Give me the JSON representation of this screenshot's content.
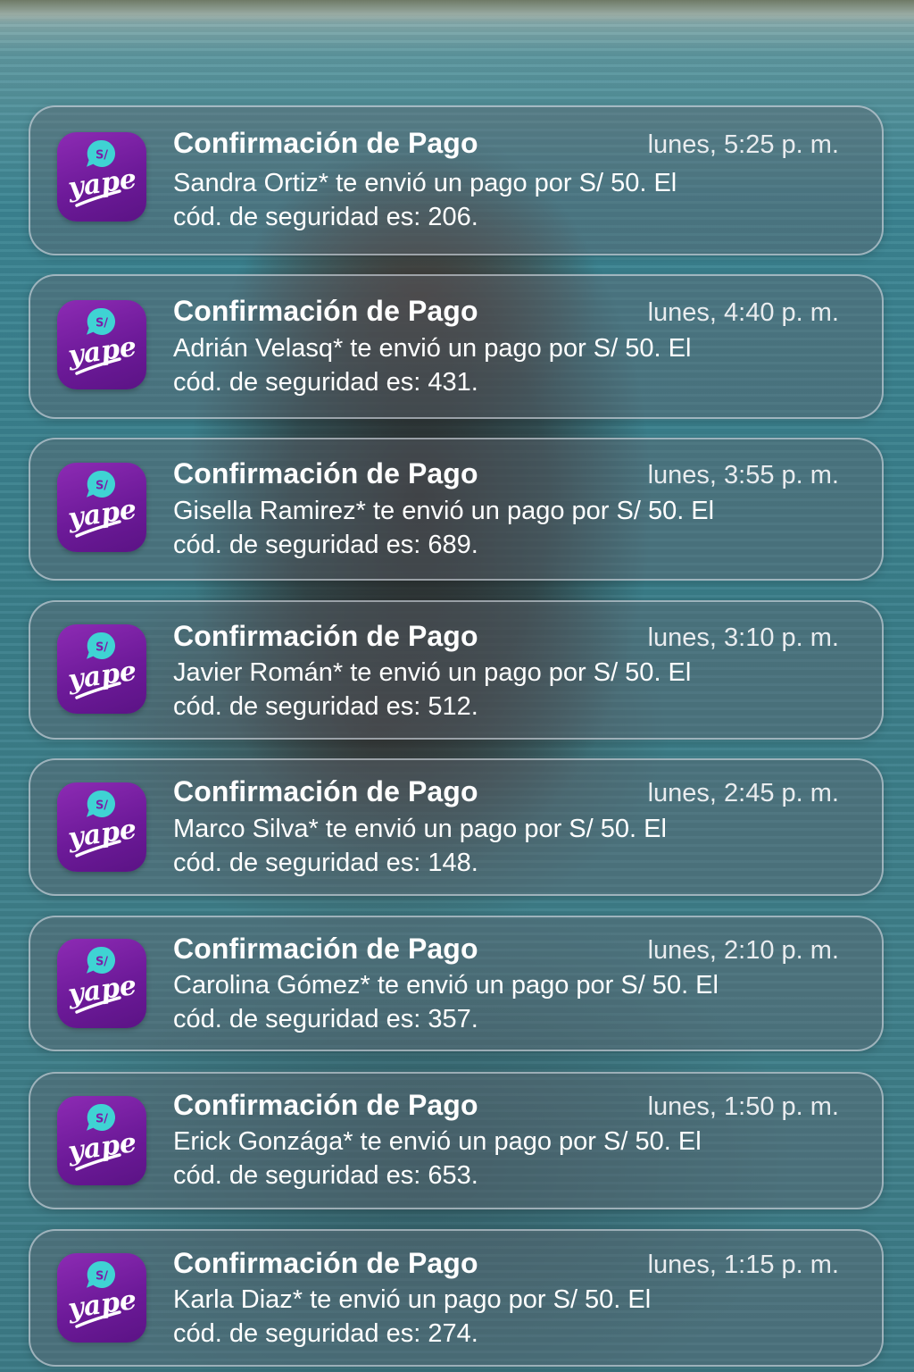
{
  "notifications": [
    {
      "app": "yape",
      "title": "Confirmación de Pago",
      "time": "lunes, 5:25 p. m.",
      "line1": "Sandra Ortiz* te envió un pago por S/ 50. El",
      "line2": "cód. de seguridad es: 206."
    },
    {
      "app": "yape",
      "title": "Confirmación de Pago",
      "time": "lunes, 4:40 p. m.",
      "line1": "Adrián Velasq* te envió un pago por S/ 50. El",
      "line2": "cód. de seguridad es: 431."
    },
    {
      "app": "yape",
      "title": "Confirmación de Pago",
      "time": "lunes, 3:55 p. m.",
      "line1": "Gisella Ramirez* te envió un pago por S/ 50. El",
      "line2": "cód. de seguridad es: 689."
    },
    {
      "app": "yape",
      "title": "Confirmación de Pago",
      "time": "lunes, 3:10 p. m.",
      "line1": "Javier Román* te envió un pago por S/ 50. El",
      "line2": "cód. de seguridad es: 512."
    },
    {
      "app": "yape",
      "title": "Confirmación de Pago",
      "time": "lunes, 2:45 p. m.",
      "line1": "Marco Silva* te envió un pago por S/ 50. El",
      "line2": "cód. de seguridad es: 148."
    },
    {
      "app": "yape",
      "title": "Confirmación de Pago",
      "time": "lunes, 2:10 p. m.",
      "line1": "Carolina Gómez* te envió un pago por S/ 50. El",
      "line2": "cód. de seguridad es: 357."
    },
    {
      "app": "yape",
      "title": "Confirmación de Pago",
      "time": "lunes, 1:50 p. m.",
      "line1": "Erick Gonzága* te envió un pago por S/ 50. El",
      "line2": "cód. de seguridad es: 653."
    },
    {
      "app": "yape",
      "title": "Confirmación de Pago",
      "time": "lunes, 1:15 p. m.",
      "line1": "Karla Diaz* te envió un pago por S/ 50. El",
      "line2": "cód. de seguridad es: 274."
    }
  ],
  "icon": {
    "currency_symbol": "S/",
    "brand_text": "yape",
    "bubble_color": "#3fd3d3",
    "background_color": "#7a1fa8"
  }
}
